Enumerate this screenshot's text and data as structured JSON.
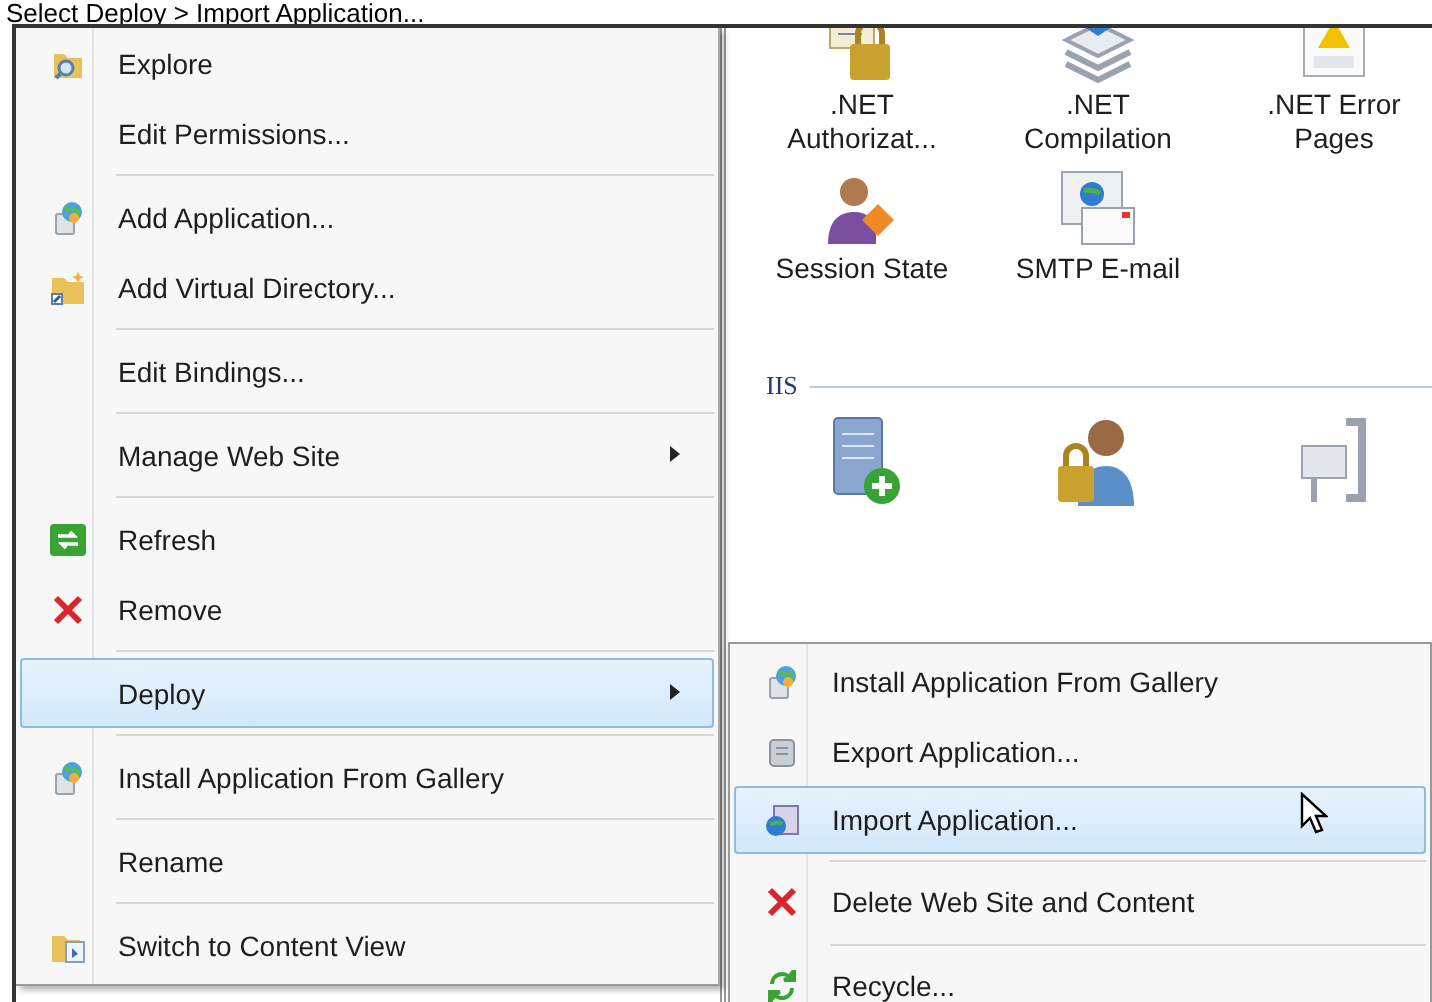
{
  "caption": "Select Deploy > Import Application...",
  "main_menu": {
    "items": [
      {
        "kind": "item",
        "label": "Explore",
        "has_submenu": false,
        "selected": false
      },
      {
        "kind": "item",
        "label": "Edit Permissions...",
        "has_submenu": false,
        "selected": false
      },
      {
        "kind": "separator"
      },
      {
        "kind": "item",
        "label": "Add Application...",
        "has_submenu": false,
        "selected": false
      },
      {
        "kind": "item",
        "label": "Add Virtual Directory...",
        "has_submenu": false,
        "selected": false
      },
      {
        "kind": "separator"
      },
      {
        "kind": "item",
        "label": "Edit Bindings...",
        "has_submenu": false,
        "selected": false
      },
      {
        "kind": "separator"
      },
      {
        "kind": "item",
        "label": "Manage Web Site",
        "has_submenu": true,
        "selected": false
      },
      {
        "kind": "separator"
      },
      {
        "kind": "item",
        "label": "Refresh",
        "has_submenu": false,
        "selected": false
      },
      {
        "kind": "item",
        "label": "Remove",
        "has_submenu": false,
        "selected": false
      },
      {
        "kind": "separator"
      },
      {
        "kind": "item",
        "label": "Deploy",
        "has_submenu": true,
        "selected": true
      },
      {
        "kind": "separator"
      },
      {
        "kind": "item",
        "label": "Install Application From Gallery",
        "has_submenu": false,
        "selected": false
      },
      {
        "kind": "separator"
      },
      {
        "kind": "item",
        "label": "Rename",
        "has_submenu": false,
        "selected": false
      },
      {
        "kind": "separator"
      },
      {
        "kind": "item",
        "label": "Switch to Content View",
        "has_submenu": false,
        "selected": false
      }
    ]
  },
  "feature_panel": {
    "rows": [
      {
        "tiles": [
          {
            "label": ".NET Authorizat..."
          },
          {
            "label": ".NET Compilation"
          },
          {
            "label": ".NET Error Pages"
          }
        ]
      },
      {
        "tiles": [
          {
            "label": "Session State"
          },
          {
            "label": "SMTP E-mail"
          }
        ]
      }
    ],
    "groups": [
      {
        "header": "IIS"
      }
    ]
  },
  "submenu": {
    "items": [
      {
        "kind": "item",
        "label": "Install Application From Gallery",
        "selected": false
      },
      {
        "kind": "item",
        "label": "Export Application...",
        "selected": false
      },
      {
        "kind": "item",
        "label": "Import Application...",
        "selected": true
      },
      {
        "kind": "separator"
      },
      {
        "kind": "item",
        "label": "Delete Web Site and Content",
        "selected": false
      },
      {
        "kind": "separator"
      },
      {
        "kind": "item",
        "label": "Recycle...",
        "selected": false
      }
    ]
  }
}
